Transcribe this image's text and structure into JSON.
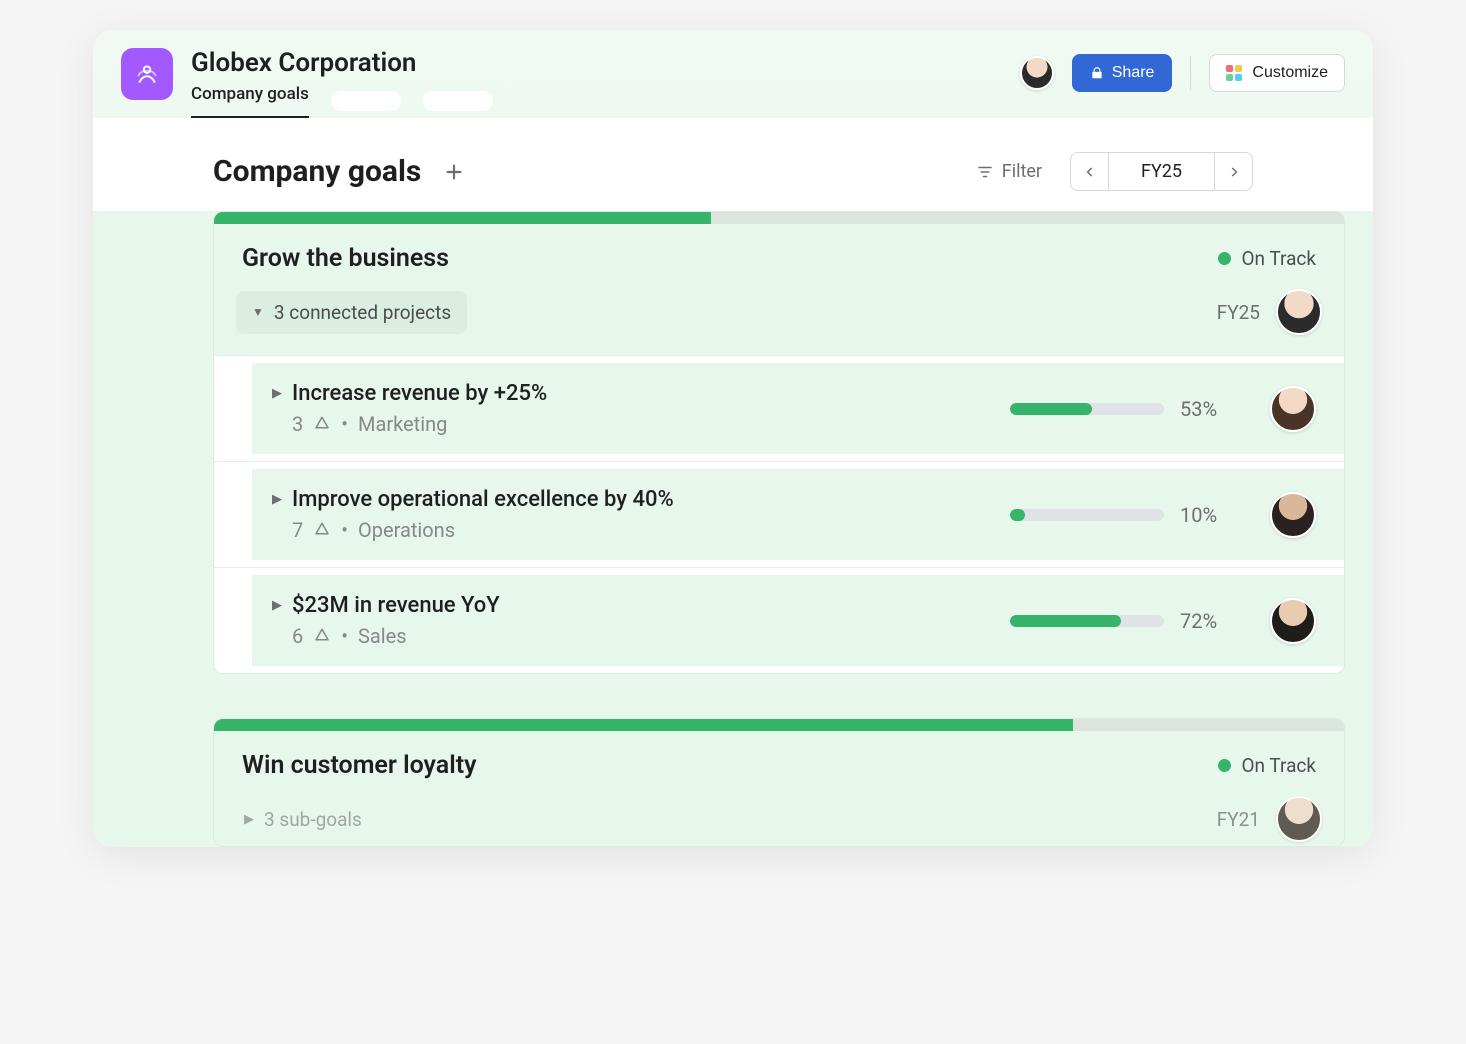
{
  "header": {
    "org_title": "Globex Corporation",
    "active_tab": "Company goals",
    "share_label": "Share",
    "customize_label": "Customize"
  },
  "toolbar": {
    "section_title": "Company goals",
    "filter_label": "Filter",
    "period_label": "FY25"
  },
  "goals": [
    {
      "title": "Grow the business",
      "status_label": "On Track",
      "status_color": "#35b46a",
      "progress_top_pct": 44,
      "connected_label": "3 connected projects",
      "period": "FY25",
      "subgoals": [
        {
          "title": "Increase revenue by +25%",
          "count": "3",
          "dept": "Marketing",
          "pct": 53
        },
        {
          "title": "Improve operational excellence by 40%",
          "count": "7",
          "dept": "Operations",
          "pct": 10
        },
        {
          "title": "$23M in revenue YoY",
          "count": "6",
          "dept": "Sales",
          "pct": 72
        }
      ]
    },
    {
      "title": "Win customer loyalty",
      "status_label": "On Track",
      "status_color": "#35b46a",
      "progress_top_pct": 76,
      "connected_label": "3 sub-goals",
      "period": "FY21",
      "subgoals": []
    }
  ]
}
